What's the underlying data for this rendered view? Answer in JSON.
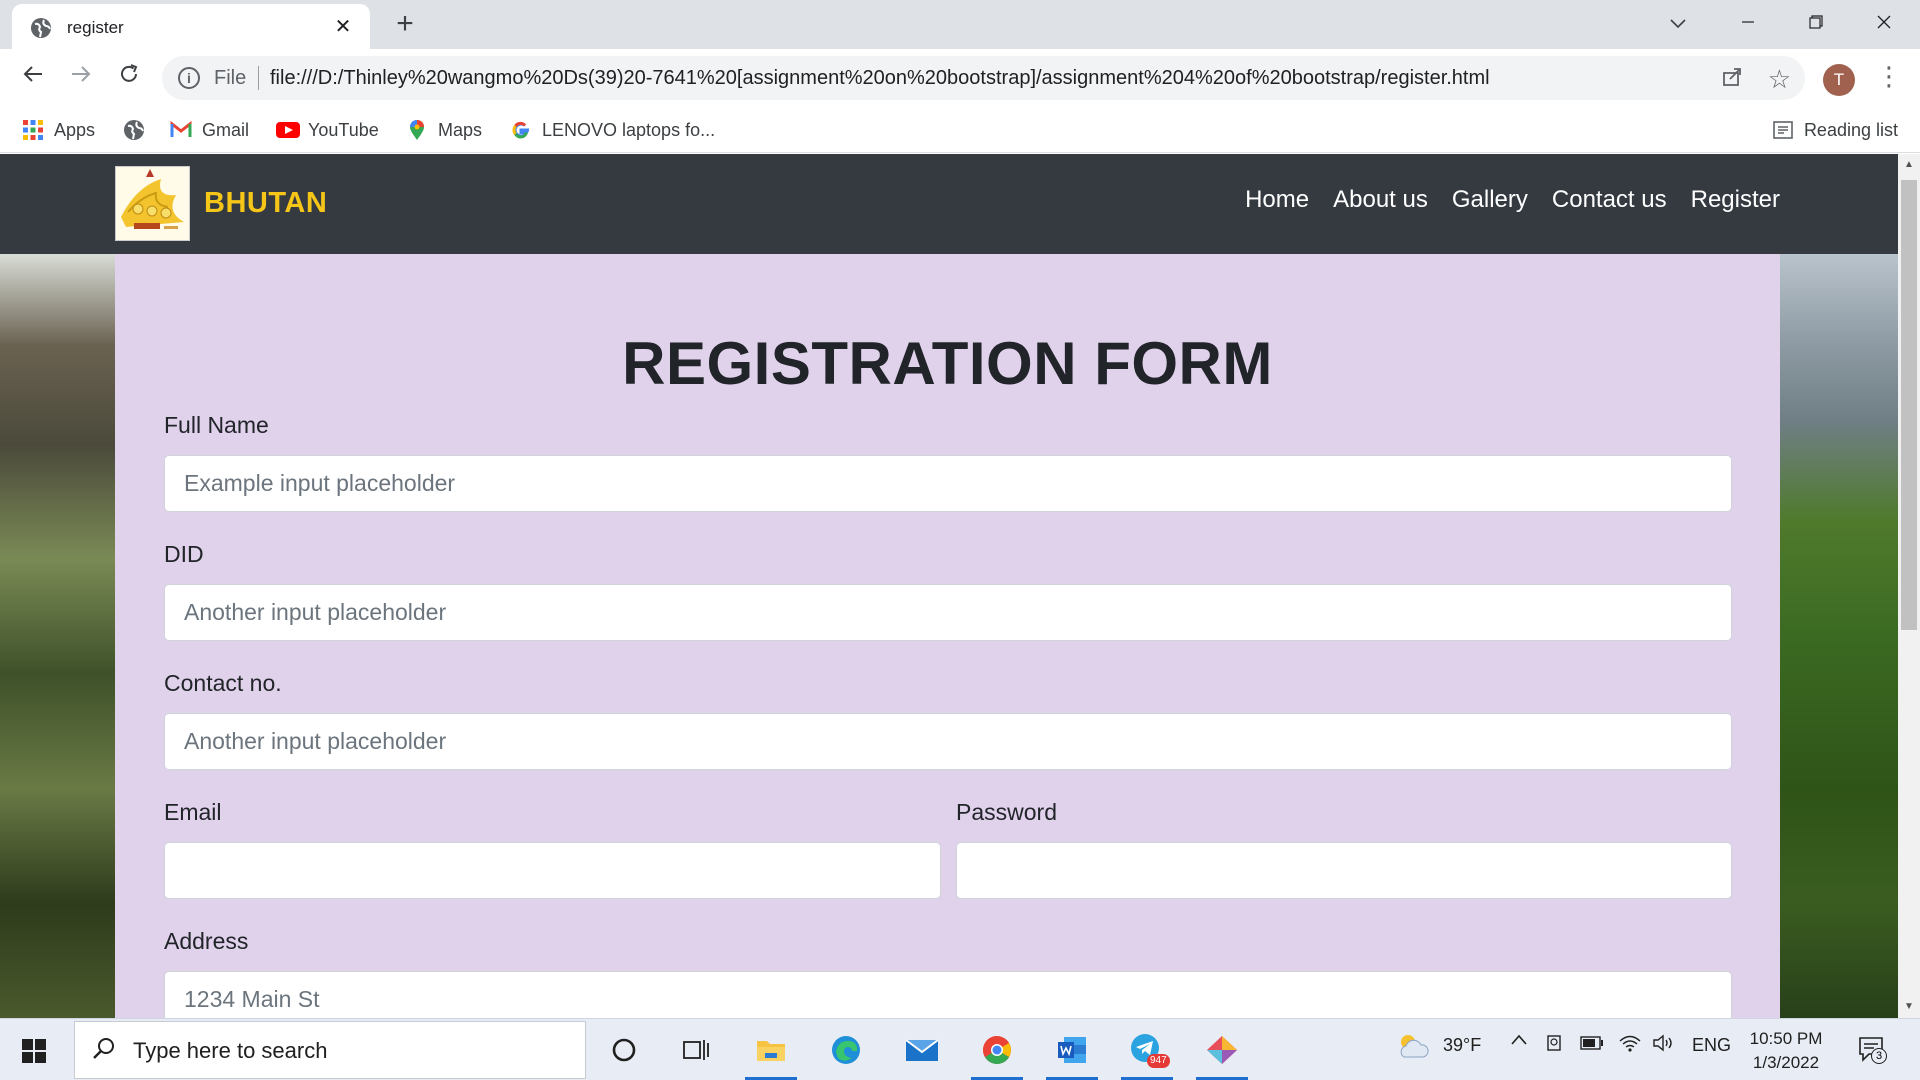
{
  "browser": {
    "tab_title": "register",
    "new_tab_label": "+",
    "url_scheme": "File",
    "url": "file:///D:/Thinley%20wangmo%20Ds(39)20-7641%20[assignment%20on%20bootstrap]/assignment%204%20of%20bootstrap/register.html",
    "profile_initial": "T",
    "bookmarks": [
      {
        "label": "Apps",
        "icon": "apps-grid-icon"
      },
      {
        "label": "",
        "icon": "globe-icon"
      },
      {
        "label": "Gmail",
        "icon": "gmail-icon"
      },
      {
        "label": "YouTube",
        "icon": "youtube-icon"
      },
      {
        "label": "Maps",
        "icon": "maps-pin-icon"
      },
      {
        "label": "LENOVO laptops fo...",
        "icon": "google-icon"
      }
    ],
    "reading_list": "Reading list"
  },
  "site": {
    "brand": "BHUTAN",
    "nav": [
      "Home",
      "About us",
      "Gallery",
      "Contact us",
      "Register"
    ],
    "colors": {
      "navbar": "#343a40",
      "brand": "#f5c518",
      "form_bg": "#e1d2ec"
    }
  },
  "form": {
    "title": "REGISTRATION FORM",
    "full_name": {
      "label": "Full Name",
      "placeholder": "Example input placeholder"
    },
    "did": {
      "label": "DID",
      "placeholder": "Another input placeholder"
    },
    "contact": {
      "label": "Contact no.",
      "placeholder": "Another input placeholder"
    },
    "email": {
      "label": "Email",
      "placeholder": ""
    },
    "password": {
      "label": "Password",
      "placeholder": ""
    },
    "address": {
      "label": "Address",
      "placeholder": "1234 Main St"
    }
  },
  "taskbar": {
    "search_placeholder": "Type here to search",
    "telegram_badge": "947",
    "weather": "39°F",
    "language": "ENG",
    "time": "10:50 PM",
    "date": "1/3/2022",
    "notifications": "3"
  }
}
